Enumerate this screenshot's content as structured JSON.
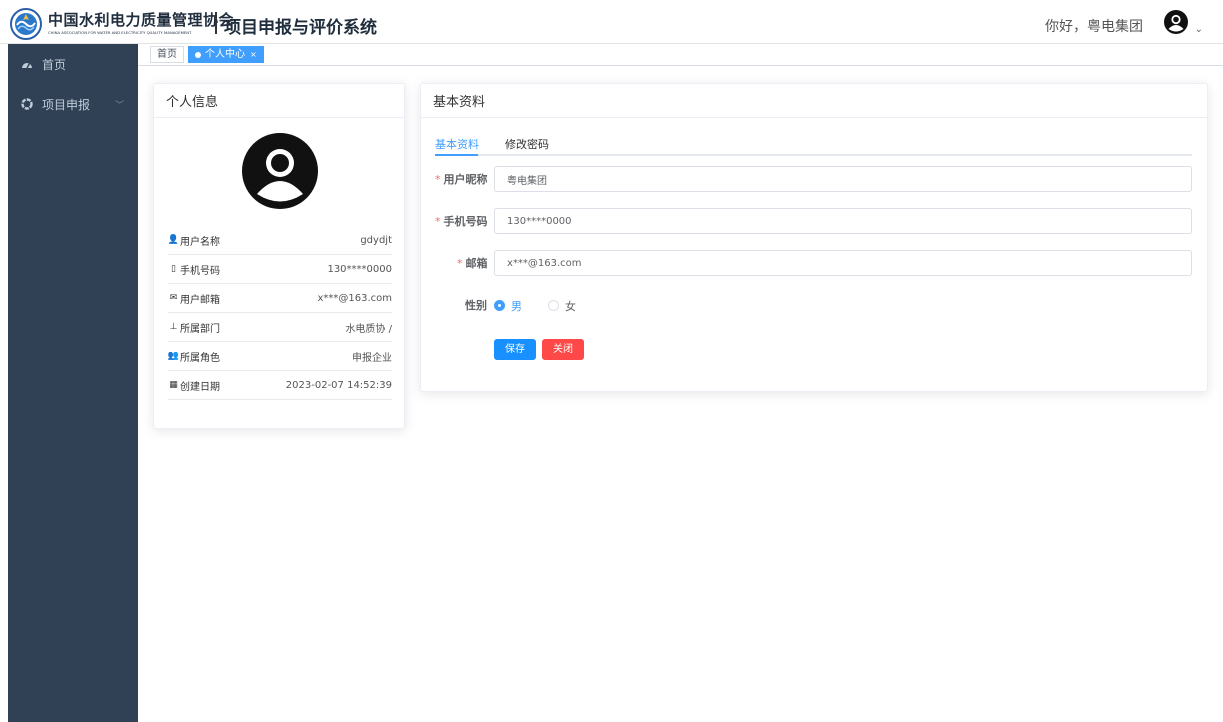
{
  "header": {
    "logo_cn": "中国水利电力质量管理协会",
    "logo_en": "CHINA ASSOCIATION FOR WATER AND ELECTRICITY QUALITY MANAGEMENT",
    "system_title": "项目申报与评价系统",
    "greeting": "你好，粤电集团",
    "avatar_icon": "user-circle-icon",
    "caret": "⌄"
  },
  "sidebar": {
    "items": [
      {
        "label": "首页",
        "icon": "dashboard-icon"
      },
      {
        "label": "项目申报",
        "icon": "circle-o-icon",
        "arrow": "﹀"
      }
    ]
  },
  "tags": {
    "home": "首页",
    "active": "个人中心",
    "close": "×"
  },
  "profile_card": {
    "title": "个人信息",
    "rows": [
      {
        "icon": "👤",
        "label": "用户名称",
        "value": "gdydjt"
      },
      {
        "icon": "▯",
        "label": "手机号码",
        "value": "130****0000"
      },
      {
        "icon": "✉",
        "label": "用户邮箱",
        "value": "x***@163.com"
      },
      {
        "icon": "⊥",
        "label": "所属部门",
        "value": "水电质协 /"
      },
      {
        "icon": "👥",
        "label": "所属角色",
        "value": "申报企业"
      },
      {
        "icon": "▦",
        "label": "创建日期",
        "value": "2023-02-07 14:52:39"
      }
    ]
  },
  "basic_card": {
    "title": "基本资料",
    "tabs": [
      "基本资料",
      "修改密码"
    ],
    "fields": {
      "nickname": {
        "label": "用户昵称",
        "value": "粤电集团"
      },
      "phone": {
        "label": "手机号码",
        "value": "130****0000"
      },
      "email": {
        "label": "邮箱",
        "value": "x***@163.com"
      },
      "gender": {
        "label": "性别",
        "options": [
          "男",
          "女"
        ],
        "selected": "男"
      }
    },
    "required_mark": "*",
    "buttons": {
      "save": "保存",
      "close": "关闭"
    }
  },
  "colors": {
    "primary": "#409eff",
    "sidebar_bg": "#304156",
    "danger": "#ff4949",
    "save_btn": "#1890ff"
  }
}
